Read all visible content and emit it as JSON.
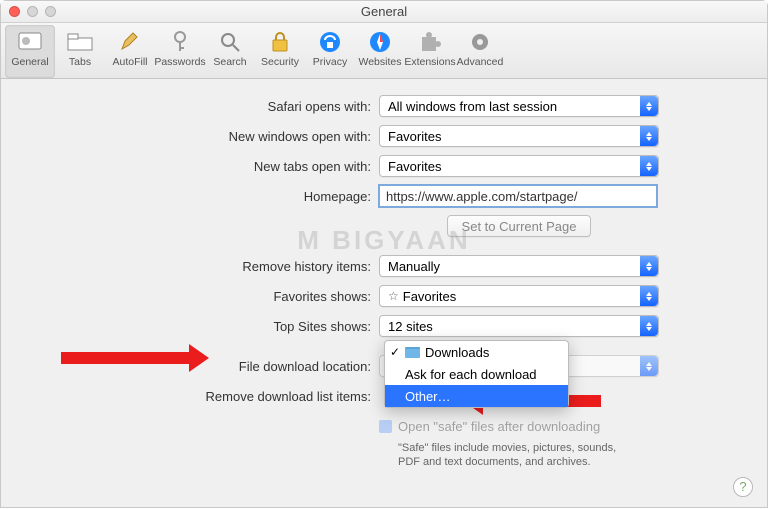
{
  "window": {
    "title": "General"
  },
  "toolbar": {
    "items": [
      {
        "label": "General"
      },
      {
        "label": "Tabs"
      },
      {
        "label": "AutoFill"
      },
      {
        "label": "Passwords"
      },
      {
        "label": "Search"
      },
      {
        "label": "Security"
      },
      {
        "label": "Privacy"
      },
      {
        "label": "Websites"
      },
      {
        "label": "Extensions"
      },
      {
        "label": "Advanced"
      }
    ]
  },
  "rows": {
    "safari_opens": {
      "label": "Safari opens with:",
      "value": "All windows from last session"
    },
    "new_windows": {
      "label": "New windows open with:",
      "value": "Favorites"
    },
    "new_tabs": {
      "label": "New tabs open with:",
      "value": "Favorites"
    },
    "homepage": {
      "label": "Homepage:",
      "value": "https://www.apple.com/startpage/"
    },
    "set_current": {
      "label": "Set to Current Page"
    },
    "remove_history": {
      "label": "Remove history items:",
      "value": "Manually"
    },
    "favorites_shows": {
      "label": "Favorites shows:",
      "value": "Favorites"
    },
    "top_sites": {
      "label": "Top Sites shows:",
      "value": "12 sites"
    },
    "download_loc": {
      "label": "File download location:"
    },
    "remove_download": {
      "label": "Remove download list items:"
    },
    "open_safe": {
      "label": "Open \"safe\" files after downloading"
    },
    "safe_note": "\"Safe\" files include movies, pictures, sounds, PDF and text documents, and archives."
  },
  "popup": {
    "items": [
      {
        "label": "Downloads",
        "checked": true,
        "icon": true
      },
      {
        "label": "Ask for each download"
      },
      {
        "label": "Other…",
        "selected": true
      }
    ]
  },
  "watermark": "M   BIGYAAN"
}
